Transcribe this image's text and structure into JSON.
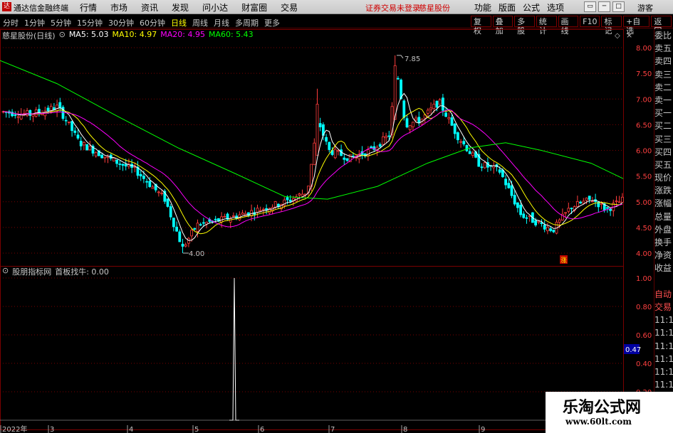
{
  "app": {
    "icon_glyph": "达",
    "title": "通达信金融终端",
    "menu": [
      "行情",
      "市场",
      "资讯",
      "发现",
      "问小达",
      "财富圈",
      "交易"
    ],
    "notice": "证券交易未登录",
    "stock_name": "慈星股份",
    "right_menu": [
      "功能",
      "版面",
      "公式",
      "选项"
    ],
    "guest": "游客"
  },
  "toolbar": {
    "periods": [
      "分时",
      "1分钟",
      "5分钟",
      "15分钟",
      "30分钟",
      "60分钟",
      "日线",
      "周线",
      "月线",
      "多周期",
      "更多"
    ],
    "active_period": "日线",
    "tools": [
      "复权",
      "叠加",
      "多股",
      "统计",
      "画线",
      "F10",
      "标记",
      "+自选",
      "返回"
    ]
  },
  "main_chart": {
    "title": "慈星股份(日线)",
    "ma": [
      {
        "label": "MA5: 5.03",
        "color": "#ffffff"
      },
      {
        "label": "MA10: 4.97",
        "color": "#ffff00"
      },
      {
        "label": "MA20: 4.95",
        "color": "#ff00ff"
      },
      {
        "label": "MA60: 5.43",
        "color": "#00ff00"
      }
    ],
    "high_label": "7.85",
    "low_label": "4.00",
    "marker_glyph": "涨",
    "diamond_glyph": "◇",
    "y_ticks": [
      "8.00",
      "7.50",
      "7.00",
      "6.50",
      "6.00",
      "5.50",
      "5.00",
      "4.50",
      "4.00"
    ]
  },
  "indicator": {
    "title": "股朋指标网",
    "name": "首板找牛: 0.00",
    "y_ticks": [
      "1.00",
      "0.80",
      "0.60",
      "0.40",
      "0.20"
    ],
    "cursor_value": "0.47"
  },
  "x_axis": [
    "2022年",
    "3",
    "4",
    "5",
    "6",
    "7",
    "8",
    "9"
  ],
  "side_column": [
    "委比",
    "卖五",
    "卖四",
    "卖三",
    "卖二",
    "卖一",
    "买一",
    "买二",
    "买三",
    "买四",
    "买五",
    "现价",
    "涨跌",
    "涨幅",
    "总量",
    "外盘",
    "换手",
    "净资",
    "收益",
    "",
    "自动",
    "交易",
    "11:13",
    "11:13",
    "11:13",
    "11:13",
    "11:13",
    "11:13",
    "11:13",
    "11:13",
    "11:13",
    "11:13"
  ],
  "watermark": {
    "title": "乐淘公式网",
    "url": "www.60lt.com"
  },
  "colors": {
    "up": "#ff3c3c",
    "down": "#00ffff",
    "ma5": "#ffffff",
    "ma10": "#ffff00",
    "ma20": "#ff00ff",
    "ma60": "#00ff00",
    "grid": "#7a0000"
  }
}
